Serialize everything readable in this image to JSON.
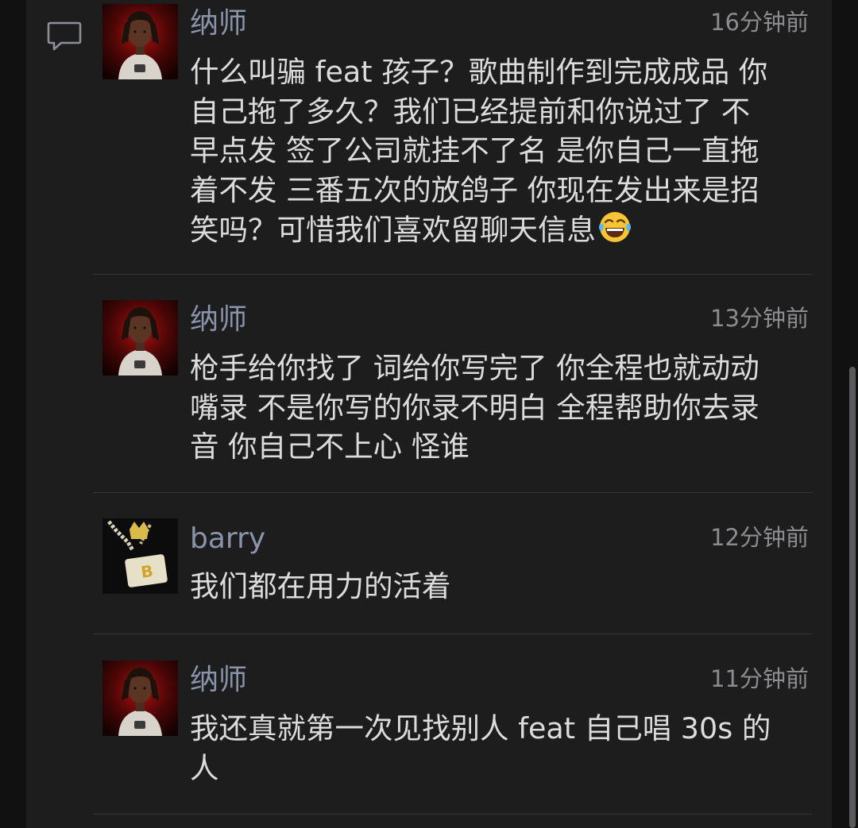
{
  "comments": [
    {
      "user": "纳师",
      "time": "16分钟前",
      "lines": [
        "什么叫骗 feat 孩子？歌曲制作到完成成品 你",
        "自己拖了多久？我们已经提前和你说过了 不",
        "早点发 签了公司就挂不了名 是你自己一直拖",
        "着不发 三番五次的放鸽子 你现在发出来是招",
        "笑吗？可惜我们喜欢留聊天信息"
      ],
      "trailing_icon": "tears-of-joy-emoji"
    },
    {
      "user": "纳师",
      "time": "13分钟前",
      "lines": [
        "枪手给你找了 词给你写完了 你全程也就动动",
        "嘴录 不是你写的你录不明白 全程帮助你去录",
        "音 你自己不上心 怪谁"
      ]
    },
    {
      "user": "barry",
      "time": "12分钟前",
      "lines": [
        "我们都在用力的活着"
      ]
    },
    {
      "user": "纳师",
      "time": "11分钟前",
      "lines": [
        "我还真就第一次见找别人 feat 自己唱 30s 的",
        "人"
      ]
    }
  ],
  "icons": {
    "comment_indicator": "comment-bubble-icon",
    "avatar_nashi": "avatar-dreadlocks-figure",
    "avatar_barry": "avatar-gold-chain-pendant"
  },
  "colors": {
    "background": "#111111",
    "panel": "#1d1d1e",
    "username": "#8a94ab",
    "text": "#dcdcdc",
    "timestamp": "#8c8c8e",
    "divider": "#353537"
  }
}
